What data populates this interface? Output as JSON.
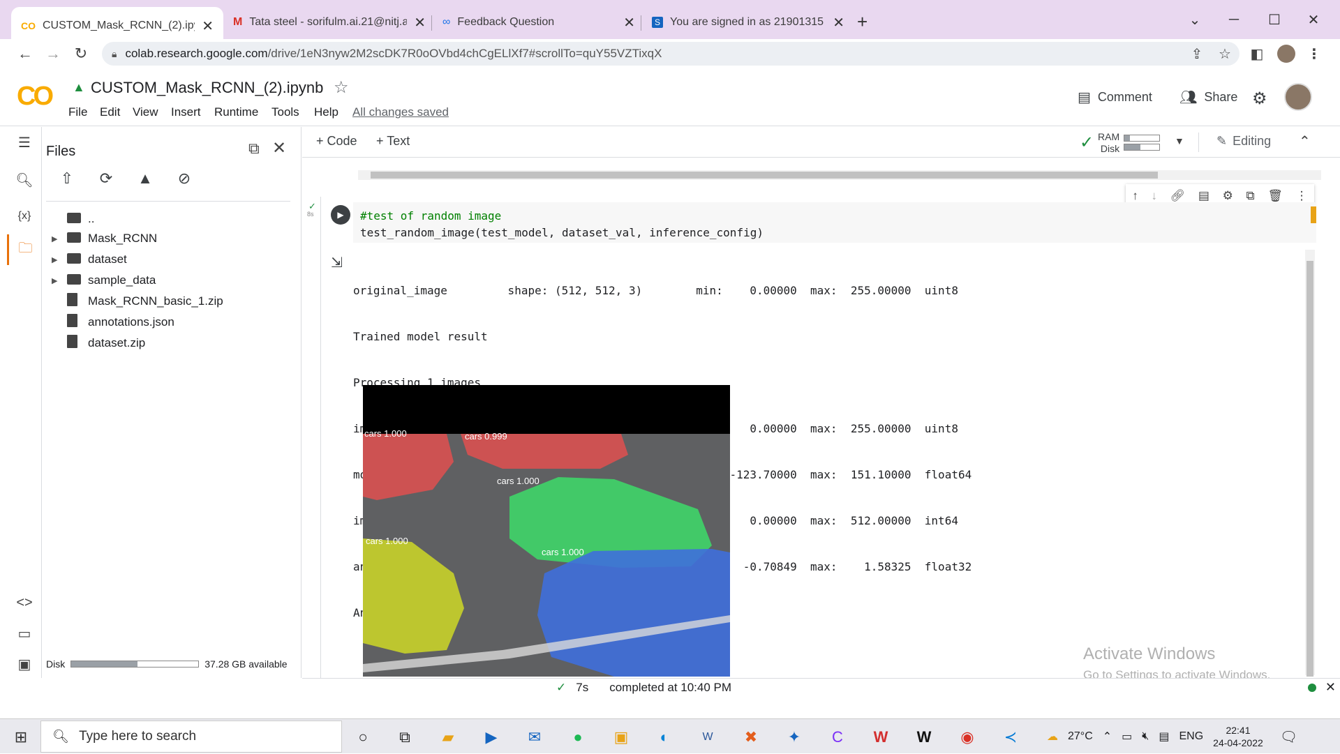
{
  "browser": {
    "tabs": [
      {
        "title": "CUSTOM_Mask_RCNN_(2).ipynb",
        "icon": "colab-icon",
        "active": true
      },
      {
        "title": "Tata steel - sorifulm.ai.21@nitj.ac",
        "icon": "gmail-icon",
        "active": false
      },
      {
        "title": "Feedback Question",
        "icon": "forms-icon",
        "active": false
      },
      {
        "title": "You are signed in as 21901315",
        "icon": "s-icon",
        "active": false
      }
    ],
    "new_tab": "+",
    "url_host": "colab.research.google.com",
    "url_path": "/drive/1eN3nyw2M2scDK7R0oOVbd4chCgELlXf7#scrollTo=quY55VZTixqX"
  },
  "colab": {
    "logo": "CO",
    "title": "CUSTOM_Mask_RCNN_(2).ipynb",
    "menu": [
      "File",
      "Edit",
      "View",
      "Insert",
      "Runtime",
      "Tools",
      "Help"
    ],
    "saved_status": "All changes saved",
    "comment_label": "Comment",
    "share_label": "Share"
  },
  "files_panel": {
    "title": "Files",
    "tree": [
      {
        "name": "..",
        "type": "up",
        "expandable": false
      },
      {
        "name": "Mask_RCNN",
        "type": "folder",
        "expandable": true
      },
      {
        "name": "dataset",
        "type": "folder",
        "expandable": true
      },
      {
        "name": "sample_data",
        "type": "folder",
        "expandable": true
      },
      {
        "name": "Mask_RCNN_basic_1.zip",
        "type": "file",
        "expandable": false
      },
      {
        "name": "annotations.json",
        "type": "file",
        "expandable": false
      },
      {
        "name": "dataset.zip",
        "type": "file",
        "expandable": false
      }
    ],
    "disk_label": "Disk",
    "disk_available": "37.28 GB available",
    "disk_used_fraction": 0.52
  },
  "toolbar": {
    "add_code": "+ Code",
    "add_text": "+ Text",
    "ram_label": "RAM",
    "disk_label": "Disk",
    "ram_fraction": 0.15,
    "disk_fraction": 0.45,
    "editing_label": "Editing"
  },
  "cell": {
    "exec_time": "8s",
    "code_line1": "#test of random image",
    "code_line2": "test_random_image(test_model, dataset_val, inference_config)",
    "output_lines": [
      "original_image         shape: (512, 512, 3)        min:    0.00000  max:  255.00000  uint8",
      "Trained model result",
      "Processing 1 images",
      "image                  shape: (512, 512, 3)        min:    0.00000  max:  255.00000  uint8",
      "molded_images          shape: (1, 512, 512, 3)     min: -123.70000  max:  151.10000  float64",
      "image_metas            shape: (1, 14)              min:    0.00000  max:  512.00000  int64",
      "anchors                shape: (1, 65472, 4)        min:   -0.70849  max:    1.58325  float32",
      "Annotation"
    ],
    "detections": [
      {
        "label": "cars 1.000",
        "color": "#e05050"
      },
      {
        "label": "cars 0.999",
        "color": "#e05050"
      },
      {
        "label": "cars 1.000",
        "color": "#3ddc6a"
      },
      {
        "label": "cars 1.000",
        "color": "#c8d12a"
      },
      {
        "label": "cars 1.000",
        "color": "#3f6fdc"
      }
    ]
  },
  "status": {
    "check": "✓",
    "time": "7s",
    "message": "completed at 10:40 PM"
  },
  "watermark": {
    "line1": "Activate Windows",
    "line2": "Go to Settings to activate Windows."
  },
  "taskbar": {
    "search_placeholder": "Type here to search",
    "temperature": "27°C",
    "language": "ENG",
    "time": "22:41",
    "date": "24-04-2022"
  }
}
